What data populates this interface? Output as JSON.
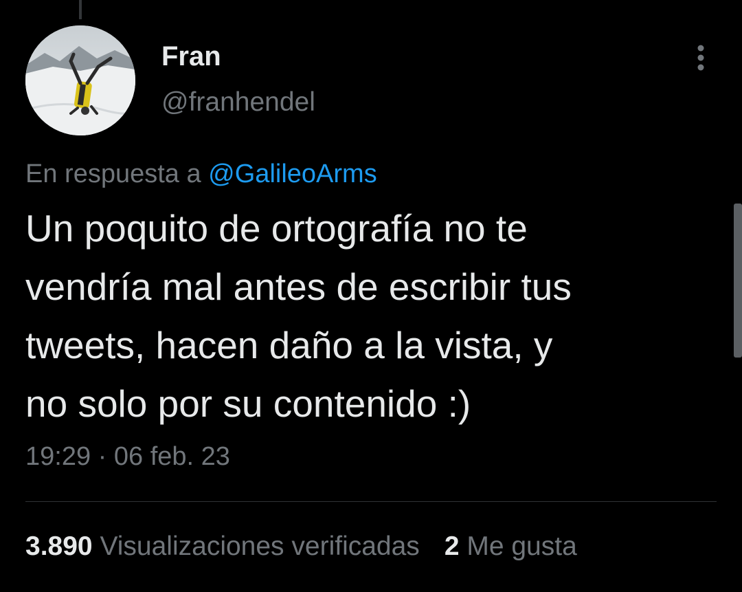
{
  "user": {
    "name": "Fran",
    "handle": "@franhendel"
  },
  "more_icon": "vertical-ellipsis-icon",
  "reply": {
    "prefix": "En respuesta a ",
    "mention": "@GalileoArms"
  },
  "tweet": {
    "text": "Un poquito de ortografía no te\nvendría mal antes de escribir tus\ntweets, hacen daño a la vista, y\nno solo por su contenido :)"
  },
  "timestamp": "19:29 · 06 feb. 23",
  "stats": {
    "views_count": "3.890",
    "views_label": "Visualizaciones verificadas",
    "likes_count": "2",
    "likes_label": "Me gusta"
  },
  "colors": {
    "background": "#000000",
    "text_primary": "#e7e9ea",
    "text_secondary": "#71767b",
    "accent": "#1d9bf0",
    "divider": "#2f3336"
  }
}
